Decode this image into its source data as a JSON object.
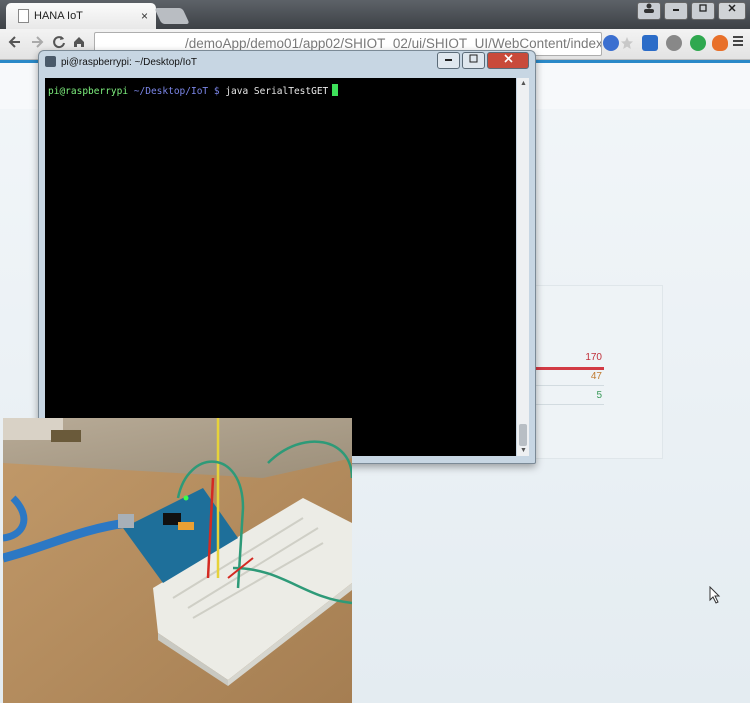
{
  "browser": {
    "tab_title": "HANA IoT",
    "tab_close": "×",
    "url": "/demoApp/demo01/app02/SHIOT_02/ui/SHIOT_UI/WebContent/index.html"
  },
  "terminal": {
    "title": "pi@raspberrypi: ~/Desktop/IoT",
    "prompt_user": "pi@raspberrypi",
    "prompt_path": " ~/Desktop/IoT $",
    "command": " java SerialTestGET"
  },
  "metrics": [
    {
      "value": "170",
      "color": "#c0303a"
    },
    {
      "value": "47",
      "color": "#c07a30"
    },
    {
      "value": "5",
      "color": "#3a9a5a"
    }
  ],
  "icons": [
    "back-icon",
    "forward-icon",
    "reload-icon",
    "home-icon",
    "star-icon",
    "menu-icon"
  ]
}
